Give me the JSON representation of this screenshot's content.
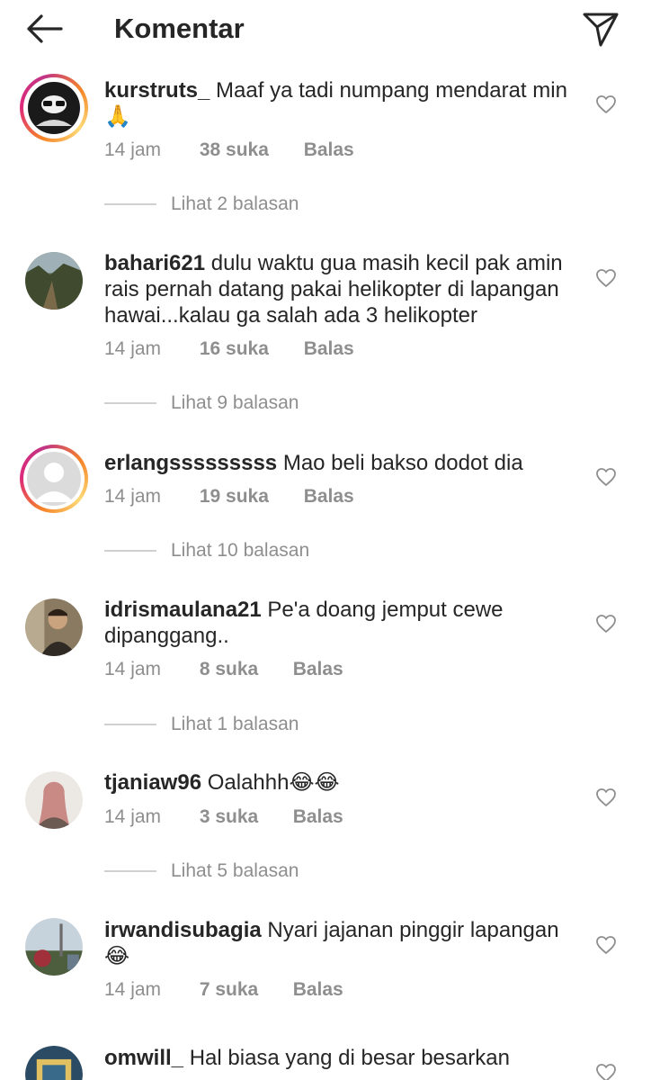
{
  "header": {
    "title": "Komentar",
    "back_icon": "arrow-left-icon",
    "send_icon": "paper-plane-icon"
  },
  "comments": [
    {
      "username": "kurstruts_",
      "text": "Maaf ya tadi numpang mendarat min 🙏",
      "time": "14 jam",
      "likes": "38 suka",
      "reply": "Balas",
      "view_replies": "Lihat 2 balasan"
    },
    {
      "username": "bahari621",
      "text": "dulu waktu gua masih kecil pak amin rais pernah datang pakai helikopter di lapangan hawai...kalau ga salah ada 3 helikopter",
      "time": "14 jam",
      "likes": "16 suka",
      "reply": "Balas",
      "view_replies": "Lihat 9 balasan"
    },
    {
      "username": "erlangsssssssss",
      "text": "Mao beli bakso dodot dia",
      "time": "14 jam",
      "likes": "19 suka",
      "reply": "Balas",
      "view_replies": "Lihat 10 balasan"
    },
    {
      "username": "idrismaulana21",
      "text": "Pe'a doang jemput cewe dipanggang..",
      "time": "14 jam",
      "likes": "8 suka",
      "reply": "Balas",
      "view_replies": "Lihat 1 balasan"
    },
    {
      "username": "tjaniaw96",
      "text": "Oalahhh😂😂",
      "time": "14 jam",
      "likes": "3 suka",
      "reply": "Balas",
      "view_replies": "Lihat 5 balasan"
    },
    {
      "username": "irwandisubagia",
      "text": "Nyari jajanan pinggir lapangan 😂",
      "time": "14 jam",
      "likes": "7 suka",
      "reply": "Balas"
    },
    {
      "username": "omwill_",
      "text": "Hal biasa yang di besar besarkan"
    }
  ],
  "colors": {
    "text": "#262626",
    "muted": "#8e8e8e",
    "story_ring_start": "#f58529",
    "story_ring_end": "#dd2a7b"
  }
}
